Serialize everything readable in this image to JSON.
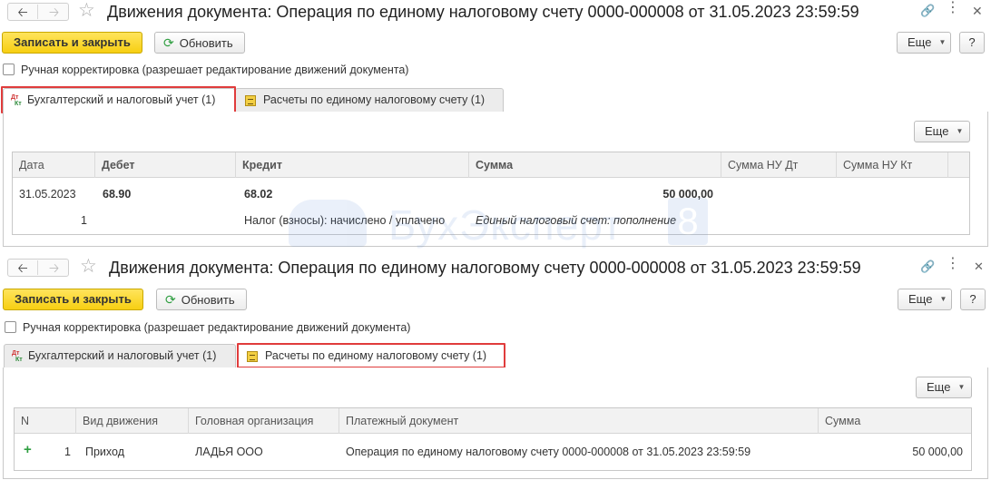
{
  "window_title": "Движения документа: Операция по единому налоговому счету 0000-000008 от 31.05.2023 23:59:59",
  "toolbar": {
    "write_close_label": "Записать и закрыть",
    "refresh_label": "Обновить",
    "more_label": "Еще",
    "help_label": "?"
  },
  "manual_adjust_label": "Ручная корректировка (разрешает редактирование движений документа)",
  "tabs": [
    {
      "label": "Бухгалтерский и налоговый учет (1)"
    },
    {
      "label": "Расчеты по единому налоговому счету (1)"
    }
  ],
  "icons": {
    "dt": "Дт",
    "kt": "Кт",
    "refresh": "refresh-icon",
    "back": "arrow-left-icon",
    "forward": "arrow-right-icon",
    "star": "star-icon",
    "link": "link-icon",
    "menu": "more-icon",
    "close": "close-icon"
  },
  "accounting_table": {
    "more_label": "Еще",
    "columns": [
      "Дата",
      "Дебет",
      "Кредит",
      "Сумма",
      "Сумма НУ Дт",
      "Сумма НУ Кт"
    ],
    "row": {
      "date": "31.05.2023",
      "debit": "68.90",
      "credit": "68.02",
      "amount": "50 000,00",
      "index": "1",
      "credit_subconto": "Налог (взносы): начислено / уплачено",
      "content": "Единый налоговый счет: пополнение"
    }
  },
  "ens_table": {
    "more_label": "Еще",
    "columns": [
      "N",
      "Вид движения",
      "Головная организация",
      "Платежный документ",
      "Сумма"
    ],
    "row": {
      "sign": "+",
      "n": "1",
      "movement": "Приход",
      "org": "ЛАДЬЯ ООО",
      "document": "Операция по единому налоговому счету 0000-000008 от 31.05.2023 23:59:59",
      "amount": "50 000,00"
    }
  },
  "watermark": {
    "text": "БухЭксперт",
    "digit": "8"
  }
}
